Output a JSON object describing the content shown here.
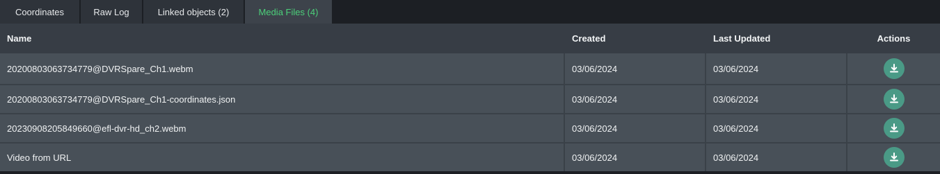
{
  "tabs": [
    {
      "label": "Coordinates",
      "active": false
    },
    {
      "label": "Raw Log",
      "active": false
    },
    {
      "label": "Linked objects (2)",
      "active": false
    },
    {
      "label": "Media Files (4)",
      "active": true
    }
  ],
  "table": {
    "headers": {
      "name": "Name",
      "created": "Created",
      "updated": "Last Updated",
      "actions": "Actions"
    },
    "rows": [
      {
        "name": "20200803063734779@DVRSpare_Ch1.webm",
        "created": "03/06/2024",
        "updated": "03/06/2024",
        "action_icon": "download-icon"
      },
      {
        "name": "20200803063734779@DVRSpare_Ch1-coordinates.json",
        "created": "03/06/2024",
        "updated": "03/06/2024",
        "action_icon": "download-icon"
      },
      {
        "name": "20230908205849660@efl-dvr-hd_ch2.webm",
        "created": "03/06/2024",
        "updated": "03/06/2024",
        "action_icon": "download-icon"
      },
      {
        "name": "Video from URL",
        "created": "03/06/2024",
        "updated": "03/06/2024",
        "action_icon": "download-icon"
      }
    ]
  },
  "colors": {
    "accent_active_tab": "#4cd07a",
    "download_button": "#4a9a86",
    "background": "#1c1f24",
    "row_background": "#485058",
    "header_background": "#373d45"
  }
}
